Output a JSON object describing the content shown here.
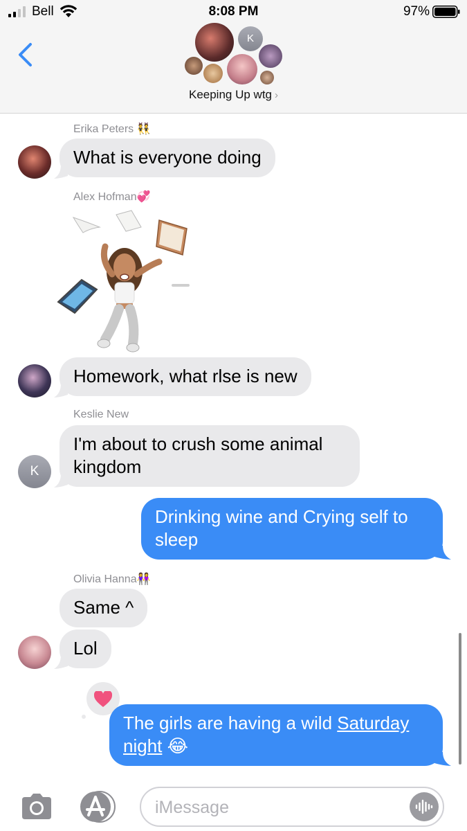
{
  "status_bar": {
    "carrier": "Bell",
    "time": "8:08 PM",
    "battery_percent": "97%",
    "battery_level": 0.97
  },
  "header": {
    "group_name": "Keeping Up wtg",
    "group_chevron": "›",
    "monogram": "K"
  },
  "messages": [
    {
      "sender": "Erika Peters",
      "sender_emoji": "👯",
      "text": "What is everyone doing"
    },
    {
      "sender": "Alex Hofman",
      "sender_emoji": "💞",
      "sticker": "bitmoji-stressed-sticker"
    },
    {
      "text": "Homework, what rlse is new"
    },
    {
      "sender": "Keslie New",
      "text": "I'm about to crush some animal kingdom",
      "avatar_initial": "K"
    },
    {
      "outgoing": true,
      "text": "Drinking wine and Crying self to sleep"
    },
    {
      "sender": "Olivia Hanna",
      "sender_emoji": "👭",
      "text": "Same ^"
    },
    {
      "text": "Lol"
    },
    {
      "outgoing": true,
      "text_before": "The girls are having a wild ",
      "text_link": "Saturday night",
      "text_after": " 😂",
      "reaction": "heart"
    }
  ],
  "input": {
    "placeholder": "iMessage"
  },
  "colors": {
    "accent": "#3a8cf6",
    "incoming_bubble": "#e9e9eb",
    "header_bg": "#f5f5f5",
    "reaction_heart": "#f0527e"
  }
}
